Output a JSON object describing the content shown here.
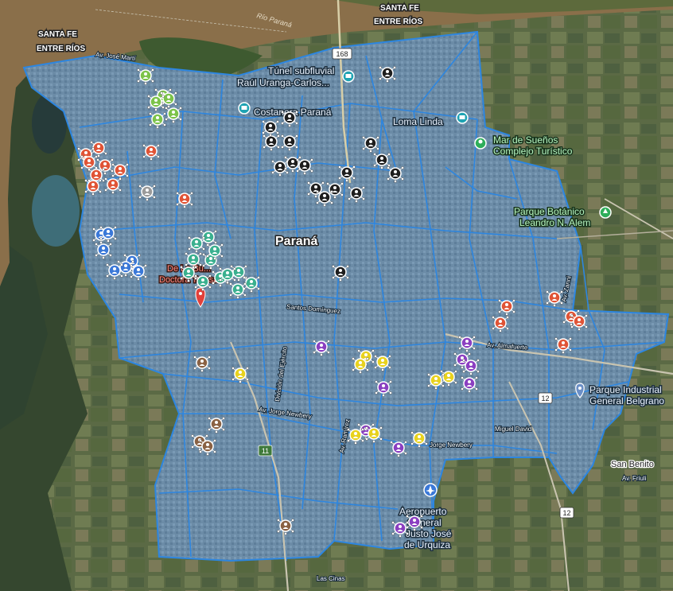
{
  "map": {
    "city_label": "Paraná",
    "river_label": "Río Paraná",
    "province_labels": {
      "north_santa_fe": "SANTA FE",
      "north_entre_rios": "ENTRE RÍOS",
      "west_santa_fe": "SANTA FE",
      "west_entre_rios": "ENTRE RÍOS"
    },
    "route_shields": {
      "r168": "168",
      "r12a": "12",
      "r12b": "12",
      "r11": "11"
    },
    "places": {
      "tunel_l1": "Túnel subfluvial",
      "tunel_l2": "Raúl Uranga-Carlos...",
      "costanera": "Costanera Paraná",
      "loma_linda": "Loma Linda",
      "mar_l1": "Mar de Sueños",
      "mar_l2": "Complejo Turístico",
      "parque_bot_l1": "Parque Botánico",
      "parque_bot_l2": "Leandro N. Alem",
      "parque_ind_l1": "Parque Industrial",
      "parque_ind_l2": "General Belgrano",
      "san_benito": "San Benito",
      "aero_l1": "Aeropuerto",
      "aero_l2": "General",
      "aero_l3": "Justo José",
      "aero_l4": "de Urquiza",
      "teresa_l1": "De La Bu...",
      "teresa_l2": "Doctora Teresa"
    },
    "streets": {
      "av_jose_marti": "Av. José Martí",
      "av_almafuerte": "Av. Almafuerte",
      "jorge_newbery_1": "Av. Jorge Newbery",
      "jorge_newbery_2": "Jorge Newbery",
      "miguel_david": "Miguel David",
      "av_friuli": "Av. Friuli",
      "santos_dominguez": "Santos Domínguez",
      "las_cinas": "Las Cinas",
      "av_ramirez": "Av. Ramírez",
      "division_ejercito": "División del Ejército",
      "av_zanni": "Av. Zanni"
    },
    "colors": {
      "marker_black": "#1e1e1e",
      "marker_red": "#e05436",
      "marker_green": "#7cc34a",
      "marker_teal": "#3ab08f",
      "marker_blue": "#3a78d8",
      "marker_purple": "#8b3fc1",
      "marker_yellow": "#e8d21e",
      "marker_brown": "#8a6244",
      "marker_gray": "#9a9a9a",
      "overlay": "#3c8fdc",
      "river": "#8a6f4a"
    }
  }
}
